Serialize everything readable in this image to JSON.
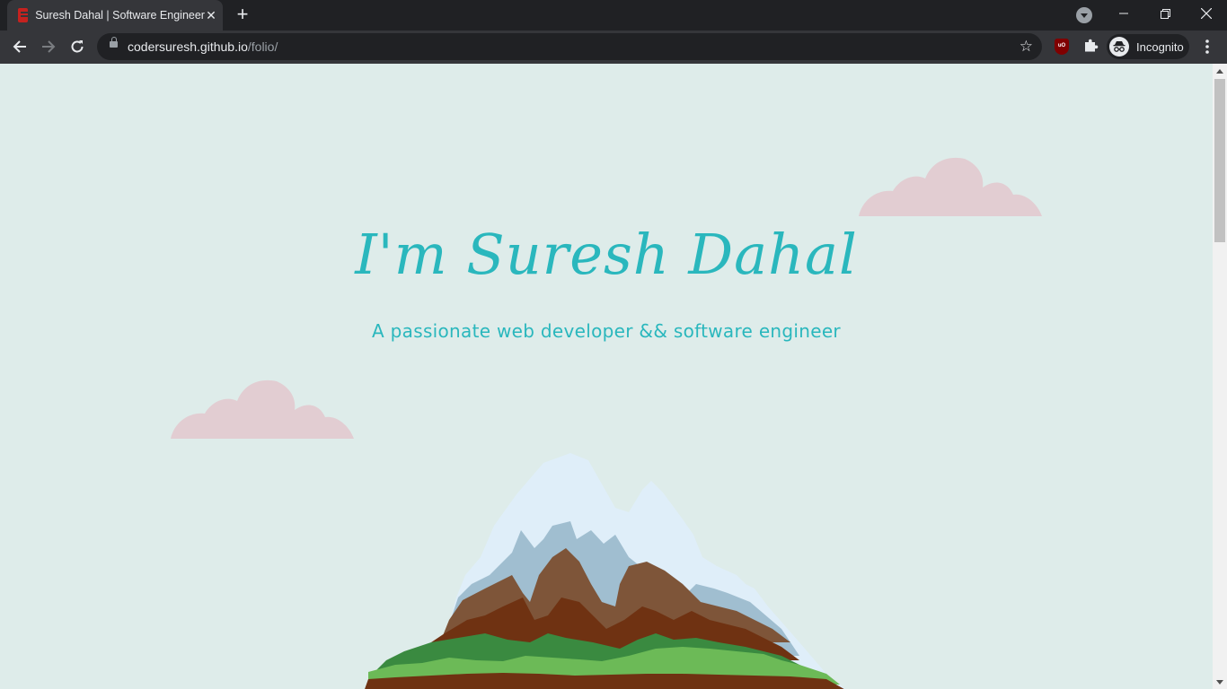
{
  "browser": {
    "tab_title": "Suresh Dahal | Software Engineer",
    "url_host": "codersuresh.github.io",
    "url_path": "/folio/",
    "profile_label": "Incognito",
    "extension_badge": "uO"
  },
  "page": {
    "title": "I'm Suresh Dahal",
    "subtitle": "A passionate web developer && software engineer"
  },
  "colors": {
    "background": "#deecea",
    "accent": "#2ab7bd",
    "cloud": "#e2cdd2"
  },
  "icons": [
    "back-icon",
    "forward-icon",
    "reload-icon",
    "lock-icon",
    "star-icon",
    "ublock-icon",
    "extensions-icon",
    "incognito-icon",
    "menu-icon",
    "tab-search-icon",
    "minimize-icon",
    "maximize-icon",
    "close-icon",
    "new-tab-icon"
  ]
}
